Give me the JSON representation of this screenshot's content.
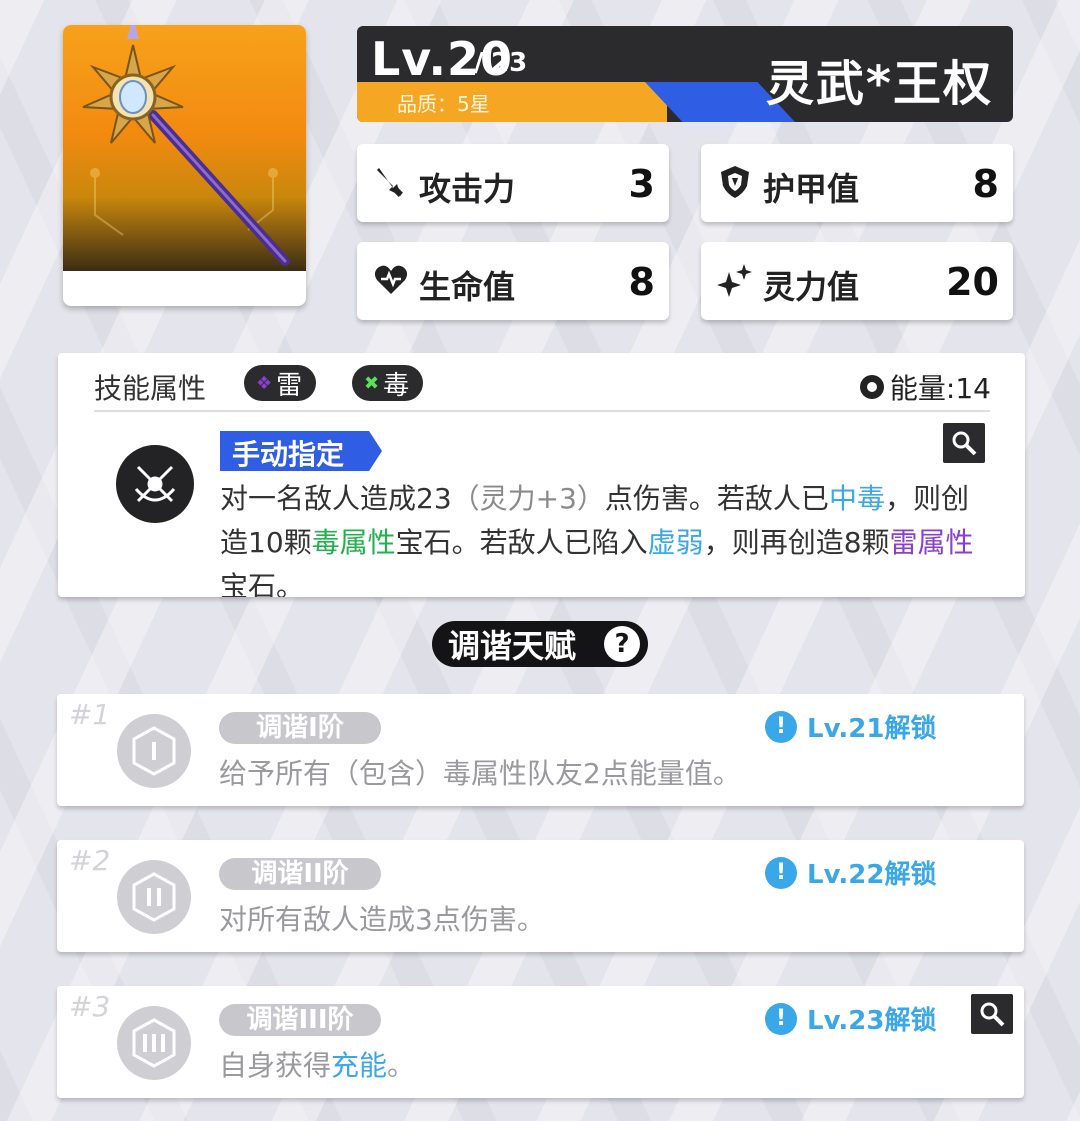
{
  "weapon": {
    "level": "Lv.20",
    "level_max": "23",
    "level_sep": "/",
    "quality": "品质：5星",
    "name": "灵武*王权"
  },
  "stats": [
    {
      "label": "攻击力",
      "value": "3",
      "icon": "attack-icon"
    },
    {
      "label": "护甲值",
      "value": "8",
      "icon": "armor-icon"
    },
    {
      "label": "生命值",
      "value": "8",
      "icon": "heart-icon"
    },
    {
      "label": "灵力值",
      "value": "20",
      "icon": "sparkle-icon"
    }
  ],
  "skill": {
    "title": "技能属性",
    "elements": [
      {
        "label": "雷",
        "icon": "thunder-icon",
        "color": "#8a3fd1"
      },
      {
        "label": "毒",
        "icon": "poison-icon",
        "color": "#22b14c"
      }
    ],
    "energy": "能量:14",
    "mode": "手动指定",
    "desc": {
      "p1": "对一名敌人造成23",
      "p2": "（灵力+3）",
      "p3": "点伤害。若敌人已",
      "p4": "中毒",
      "p5": "，则创造10颗",
      "p6": "毒属性",
      "p7": "宝石。若敌人已陷入",
      "p8": "虚弱",
      "p9": "，则再创造8颗",
      "p10": "雷属性",
      "p11": "宝石。"
    }
  },
  "talent_header": {
    "label": "调谐天赋",
    "help": "?"
  },
  "talents": [
    {
      "num": "#1",
      "tag": "调谐I阶",
      "unlock": "Lv.21解锁",
      "desc_a": "给予所有（包含）毒属性队友2点能量值。",
      "desc_b": ""
    },
    {
      "num": "#2",
      "tag": "调谐II阶",
      "unlock": "Lv.22解锁",
      "desc_a": "对所有敌人造成3点伤害。",
      "desc_b": ""
    },
    {
      "num": "#3",
      "tag": "调谐III阶",
      "unlock": "Lv.23解锁",
      "desc_a": "自身获得",
      "desc_hl": "充能",
      "desc_b": "。"
    }
  ],
  "colors": {
    "accent_blue": "#2f5de3",
    "quality_orange": "#f5a623",
    "link_blue": "#3aa7e8",
    "poison_green": "#22b14c",
    "thunder_purple": "#8a3fd1"
  }
}
